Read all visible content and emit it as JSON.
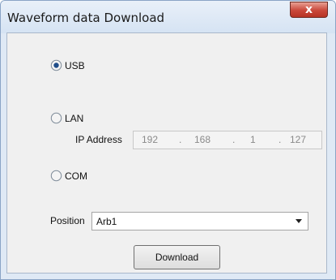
{
  "window": {
    "title": "Waveform data Download",
    "close_glyph": "x"
  },
  "connection": {
    "usb_label": "USB",
    "lan_label": "LAN",
    "com_label": "COM",
    "selected": "USB"
  },
  "ip": {
    "label": "IP Address",
    "octets": [
      "192",
      "168",
      "1",
      "127"
    ],
    "separator": "."
  },
  "position": {
    "label": "Position",
    "value": "Arb1"
  },
  "actions": {
    "download_label": "Download"
  }
}
